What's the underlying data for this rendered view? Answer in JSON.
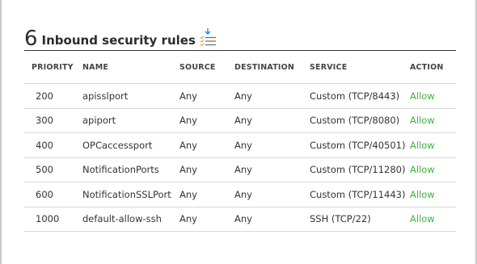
{
  "header": {
    "count": "6",
    "title": "Inbound security rules",
    "icon": "sort-list-icon",
    "icon_color": "#2d8ad4",
    "icon_accent": "#e8a23a"
  },
  "table": {
    "columns": [
      "PRIORITY",
      "NAME",
      "SOURCE",
      "DESTINATION",
      "SERVICE",
      "ACTION"
    ],
    "rows": [
      {
        "priority": "200",
        "name": "apisslport",
        "source": "Any",
        "destination": "Any",
        "service": "Custom (TCP/8443)",
        "action": "Allow"
      },
      {
        "priority": "300",
        "name": "apiport",
        "source": "Any",
        "destination": "Any",
        "service": "Custom (TCP/8080)",
        "action": "Allow"
      },
      {
        "priority": "400",
        "name": "OPCaccessport",
        "source": "Any",
        "destination": "Any",
        "service": "Custom (TCP/40501)",
        "action": "Allow"
      },
      {
        "priority": "500",
        "name": "NotificationPorts",
        "source": "Any",
        "destination": "Any",
        "service": "Custom (TCP/11280)",
        "action": "Allow"
      },
      {
        "priority": "600",
        "name": "NotificationSSLPort",
        "source": "Any",
        "destination": "Any",
        "service": "Custom (TCP/11443)",
        "action": "Allow"
      },
      {
        "priority": "1000",
        "name": "default-allow-ssh",
        "source": "Any",
        "destination": "Any",
        "service": "SSH (TCP/22)",
        "action": "Allow"
      }
    ],
    "action_color": "#3cb43c"
  }
}
